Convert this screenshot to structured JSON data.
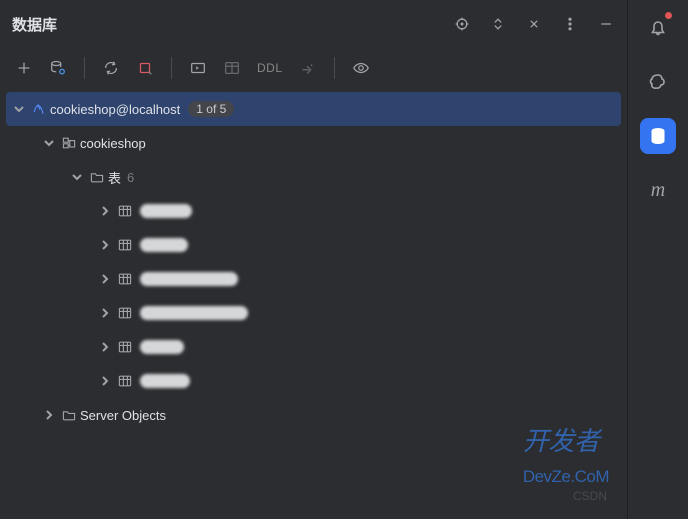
{
  "header": {
    "title": "数据库"
  },
  "toolbar": {
    "ddl_label": "DDL"
  },
  "connection": {
    "label": "cookieshop@localhost",
    "badge": "1 of 5"
  },
  "schema": {
    "label": "cookieshop",
    "tables_folder_label": "表",
    "tables_count": "6",
    "tables": [
      {
        "smudge_w": 52
      },
      {
        "smudge_w": 48
      },
      {
        "smudge_w": 98
      },
      {
        "smudge_w": 108
      },
      {
        "smudge_w": 44
      },
      {
        "smudge_w": 50
      }
    ],
    "server_objects_label": "Server Objects"
  },
  "watermark": {
    "large": "开发者",
    "sub": "DevZe.CoM",
    "csdn": "CSDN"
  }
}
